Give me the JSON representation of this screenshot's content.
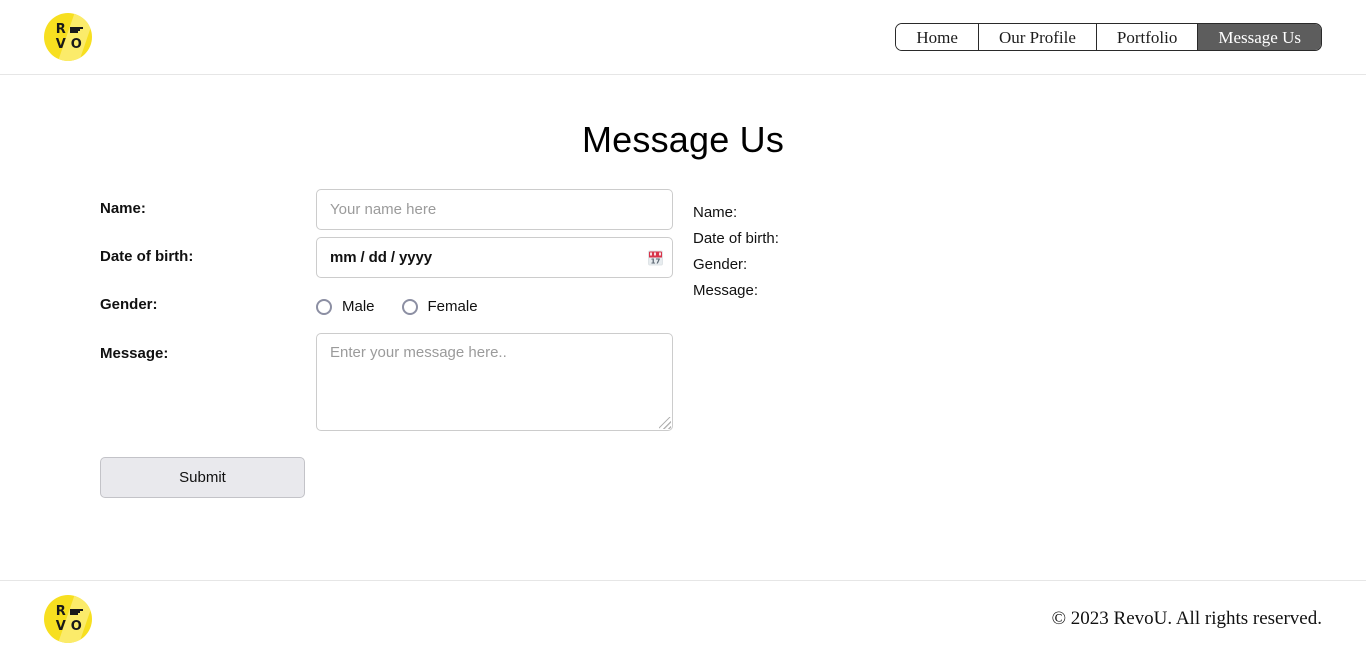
{
  "header": {
    "logo_alt": "RevoU logo",
    "logo_letters": [
      "R",
      "E",
      "V",
      "O"
    ],
    "nav": [
      {
        "label": "Home",
        "active": false
      },
      {
        "label": "Our Profile",
        "active": false
      },
      {
        "label": "Portfolio",
        "active": false
      },
      {
        "label": "Message Us",
        "active": true
      }
    ]
  },
  "main": {
    "title": "Message Us",
    "form": {
      "name": {
        "label": "Name:",
        "placeholder": "Your name here",
        "value": ""
      },
      "dob": {
        "label": "Date of birth:",
        "placeholder": "mm / dd / yyyy",
        "value": "",
        "calendar_day": "17"
      },
      "gender": {
        "label": "Gender:",
        "options": [
          {
            "label": "Male",
            "selected": false
          },
          {
            "label": "Female",
            "selected": false
          }
        ]
      },
      "message": {
        "label": "Message:",
        "placeholder": "Enter your message here..",
        "value": ""
      },
      "submit_label": "Submit"
    },
    "output": {
      "lines": [
        "Name:",
        "Date of birth:",
        "Gender:",
        "Message:"
      ]
    }
  },
  "footer": {
    "logo_alt": "RevoU logo",
    "copyright": "© 2023 RevoU. All rights reserved."
  },
  "colors": {
    "brand_yellow": "#f7df20",
    "brand_yellow_light": "#fbeb6a",
    "nav_active_bg": "#5d5d5d",
    "calendar_red": "#d8344a",
    "border_gray": "#cccccc",
    "placeholder_gray": "#9b9b9b"
  }
}
